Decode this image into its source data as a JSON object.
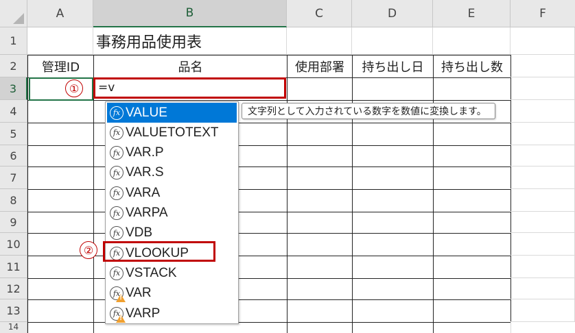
{
  "columns": [
    "A",
    "B",
    "C",
    "D",
    "E",
    "F"
  ],
  "rows": [
    "1",
    "2",
    "3",
    "4",
    "5",
    "6",
    "7",
    "8",
    "9",
    "10",
    "11",
    "12",
    "13",
    "14"
  ],
  "sheet": {
    "title": "事務用品使用表",
    "headers": {
      "a": "管理ID",
      "b": "品名",
      "c": "使用部署",
      "d": "持ち出し日",
      "e": "持ち出し数"
    },
    "edit_value": "=v"
  },
  "callouts": {
    "one": "①",
    "two": "②"
  },
  "autocomplete": {
    "items": [
      {
        "label": "VALUE",
        "icon": "function-icon",
        "warning": false
      },
      {
        "label": "VALUETOTEXT",
        "icon": "function-icon",
        "warning": false
      },
      {
        "label": "VAR.P",
        "icon": "function-icon",
        "warning": false
      },
      {
        "label": "VAR.S",
        "icon": "function-icon",
        "warning": false
      },
      {
        "label": "VARA",
        "icon": "function-icon",
        "warning": false
      },
      {
        "label": "VARPA",
        "icon": "function-icon",
        "warning": false
      },
      {
        "label": "VDB",
        "icon": "function-icon",
        "warning": false
      },
      {
        "label": "VLOOKUP",
        "icon": "function-icon",
        "warning": false
      },
      {
        "label": "VSTACK",
        "icon": "function-icon",
        "warning": false
      },
      {
        "label": "VAR",
        "icon": "function-warning-icon",
        "warning": true
      },
      {
        "label": "VARP",
        "icon": "function-warning-icon",
        "warning": true
      }
    ],
    "selected_index": 0,
    "tooltip": "文字列として入力されている数字を数値に変換します。"
  },
  "colors": {
    "accent": "#217346",
    "highlight": "#c00000",
    "selection": "#0078d7"
  }
}
